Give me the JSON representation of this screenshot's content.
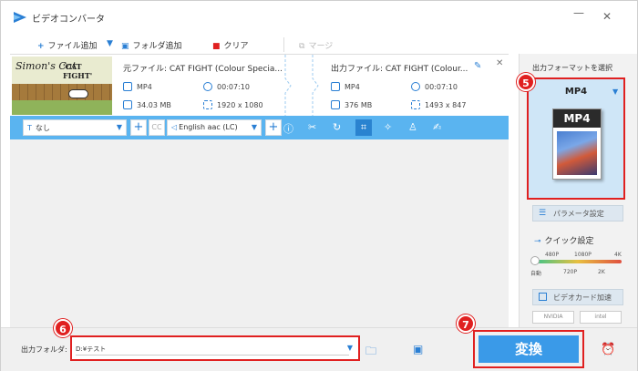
{
  "window": {
    "title": "ビデオコンバータ"
  },
  "toolbar": {
    "add_file": "ファイル追加",
    "add_folder": "フォルダ追加",
    "clear": "クリア",
    "merge": "マージ"
  },
  "file": {
    "source_name": "元ファイル: CAT FIGHT (Colour Specia...",
    "output_name": "出力ファイル: CAT FIGHT (Colour...",
    "thumb_title": "Simon's Cat",
    "thumb_subtitle": "'CAT FIGHT'",
    "source": {
      "format": "MP4",
      "duration": "00:07:10",
      "size": "34.03 MB",
      "resolution": "1920 x 1080"
    },
    "output": {
      "format": "MP4",
      "duration": "00:07:10",
      "size": "376 MB",
      "resolution": "1493 x 847"
    }
  },
  "editbar": {
    "subtitle": "なし",
    "cc": "CC",
    "audio": "English aac (LC)"
  },
  "right_panel": {
    "title": "出力フォーマットを選択",
    "format": "MP4",
    "format_icon_label": "MP4",
    "param_button": "パラメータ設定",
    "quick_title": "クイック設定",
    "quick_labels_top": [
      "480P",
      "1080P",
      "4K"
    ],
    "quick_labels_bottom": [
      "自動",
      "720P",
      "2K"
    ],
    "quick_level": 0,
    "gpu_button": "ビデオカード加速",
    "vendors": [
      "NVIDIA",
      "intel"
    ]
  },
  "bottom": {
    "output_label": "出力フォルダ:",
    "output_path": "D:¥テスト",
    "convert": "変換"
  },
  "markers": [
    "5",
    "6",
    "7"
  ],
  "colors": {
    "accent": "#3a9ae8",
    "editbar": "#5ab4f0",
    "highlight": "#e02020"
  }
}
